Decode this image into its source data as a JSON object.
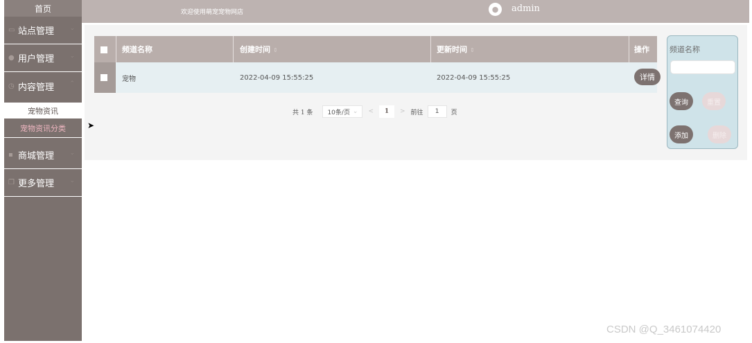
{
  "sidebar": {
    "home": "首页",
    "menus": [
      {
        "label": "站点管理",
        "icon": "monitor-icon"
      },
      {
        "label": "用户管理",
        "icon": "user-icon"
      },
      {
        "label": "内容管理",
        "icon": "clock-icon"
      }
    ],
    "submenus": [
      "宠物资讯",
      "宠物资讯分类"
    ],
    "menus2": [
      {
        "label": "商城管理",
        "icon": "lock-icon"
      },
      {
        "label": "更多管理",
        "icon": "copy-icon"
      }
    ]
  },
  "header": {
    "welcome": "欢迎使用萌宠宠物网店",
    "username": "admin"
  },
  "table": {
    "columns": [
      "频道名称",
      "创建时间",
      "更新时间",
      "操作"
    ],
    "rows": [
      {
        "name": "宠物",
        "created": "2022-04-09 15:55:25",
        "updated": "2022-04-09 15:55:25",
        "action": "详情"
      }
    ]
  },
  "pagination": {
    "total": "共 1 条",
    "page_size": "10条/页",
    "current_page": "1",
    "goto_label": "前往",
    "goto_value": "1",
    "page_unit": "页"
  },
  "search": {
    "label": "频道名称",
    "query_button": "查询",
    "reset_button": "重置",
    "add_button": "添加",
    "delete_button": "删除"
  },
  "watermark": "CSDN @Q_3461074420",
  "colors": {
    "sidebar": "#7b716e",
    "header": "#bdb3b1",
    "accent": "#7d7270",
    "search_panel": "#cfe3e9"
  }
}
